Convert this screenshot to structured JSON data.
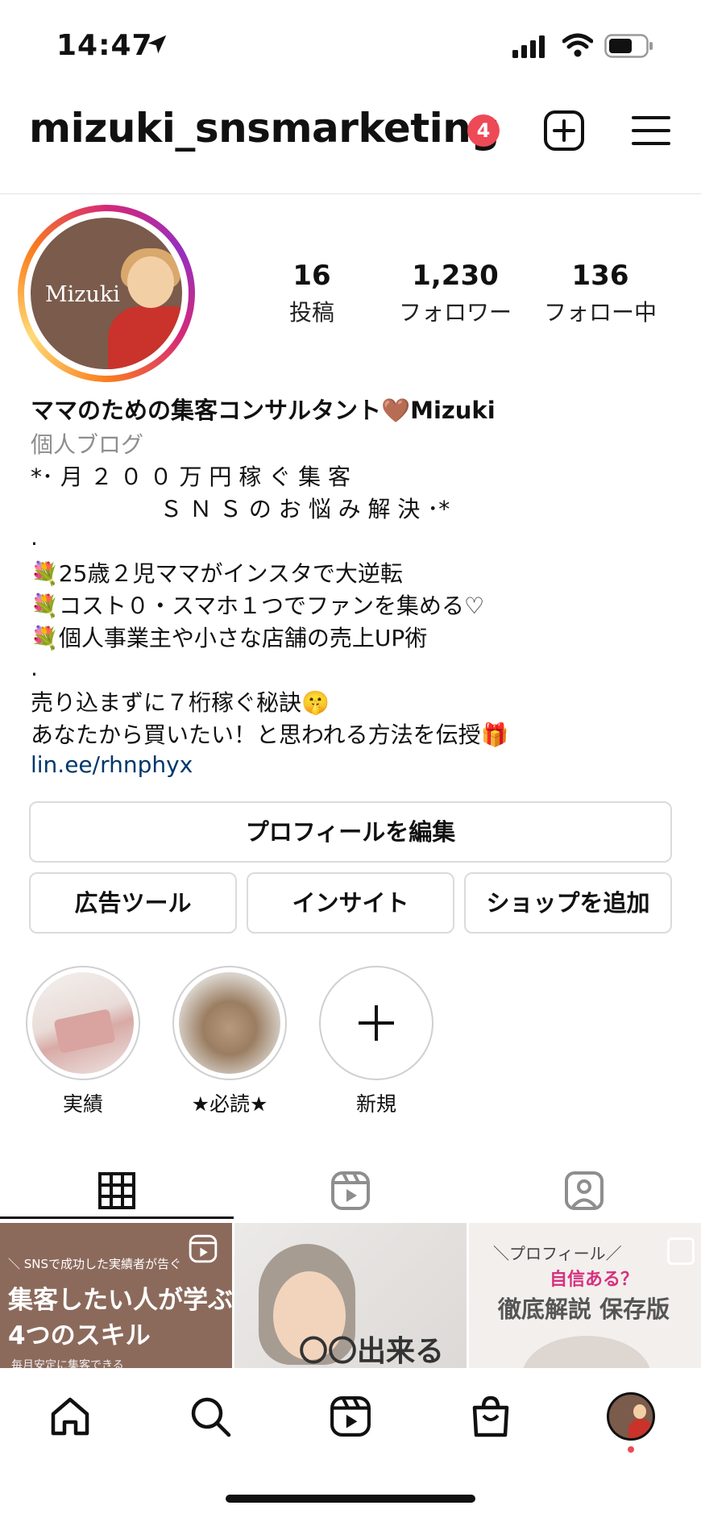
{
  "status_bar": {
    "time": "14:47"
  },
  "header": {
    "username": "mizuki_snsmarketing",
    "notification_count": "4"
  },
  "avatar": {
    "overlay_text": "Mizuki"
  },
  "stats": [
    {
      "value": "16",
      "label": "投稿"
    },
    {
      "value": "1,230",
      "label": "フォロワー"
    },
    {
      "value": "136",
      "label": "フォロー中"
    }
  ],
  "bio": {
    "name": "ママのための集客コンサルタント🤎Mizuki",
    "category": "個人ブログ",
    "lines": [
      "*･ 月 ２ ０ ０ 万 円 稼 ぐ 集 客",
      "                  Ｓ Ｎ Ｓ の お 悩 み 解 決 ･*",
      ".",
      "💐25歳２児ママがインスタで大逆転",
      "💐コスト０・スマホ１つでファンを集める♡",
      "💐個人事業主や小さな店舗の売上UP術",
      ".",
      "売り込まずに７桁稼ぐ秘訣🤫",
      "あなたから買いたい！と思われる方法を伝授🎁"
    ],
    "link": "lin.ee/rhnphyx"
  },
  "buttons": {
    "edit_profile": "プロフィールを編集",
    "ad_tools": "広告ツール",
    "insights": "インサイト",
    "add_shop": "ショップを追加"
  },
  "highlights": [
    {
      "label": "実績"
    },
    {
      "label": "★必読★"
    },
    {
      "label": "新規"
    }
  ],
  "grid": [
    {
      "top_text": "＼ SNSで成功した実績者が告ぐ",
      "title1": "集客したい人が学ぶ",
      "title2": "4つのスキル",
      "bottom_text": "毎月安定に集客できる"
    },
    {
      "overlay_text": "〇〇出来る"
    },
    {
      "top_text": "＼プロフィール／",
      "accent_text": "自信ある？",
      "title": "徹底解説 保存版"
    }
  ],
  "colors": {
    "accent_red": "#ed4956",
    "link_blue": "#00376b",
    "grid1_bg": "#8b6a5c"
  }
}
